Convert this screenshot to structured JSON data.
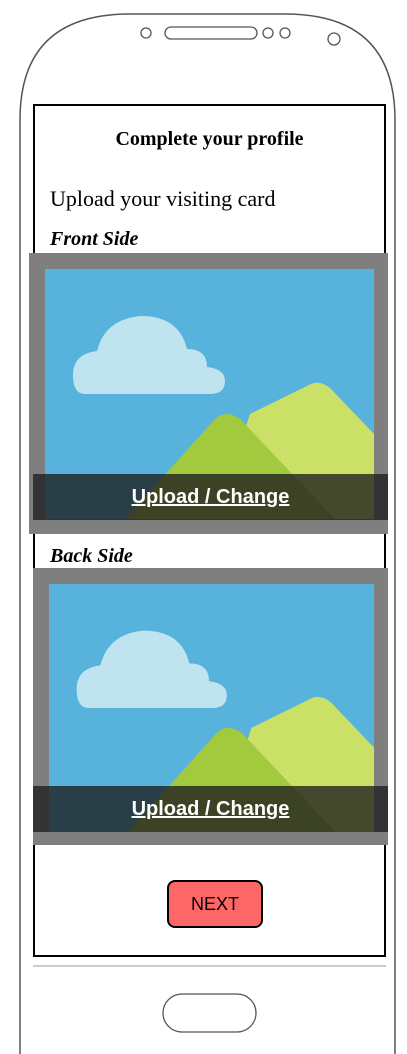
{
  "screen": {
    "title": "Complete your profile",
    "subtitle": "Upload your visiting card"
  },
  "front": {
    "label": "Front Side",
    "upload_label": "Upload / Change "
  },
  "back": {
    "label": "Back Side",
    "upload_label": "Upload / Change "
  },
  "next_button": {
    "label": "NEXT"
  },
  "colors": {
    "sky": "#57b3dc",
    "cloud": "#c0e3f0",
    "hill_front": "#a3c93e",
    "hill_back": "#cbe067",
    "frame": "#7f7f7f",
    "next_bg": "#ff6666"
  },
  "icons": {
    "front_image": "image-placeholder-icon",
    "back_image": "image-placeholder-icon",
    "phone_speaker": "speaker-slot-icon",
    "phone_home": "home-button-icon"
  }
}
